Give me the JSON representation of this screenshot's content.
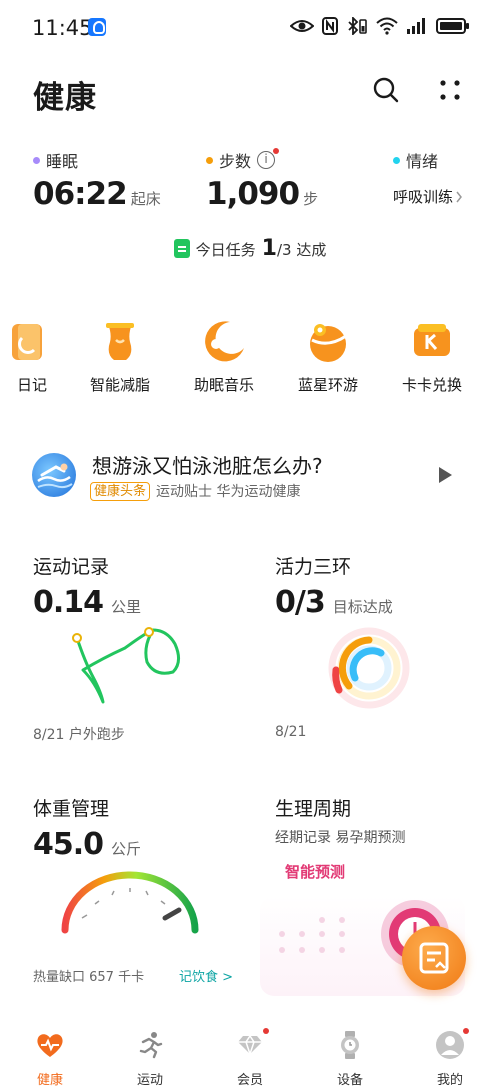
{
  "status_bar": {
    "time": "11:45"
  },
  "header": {
    "title": "健康"
  },
  "metrics": {
    "sleep": {
      "label": "睡眠",
      "value": "06:22",
      "unit": "起床",
      "color": "#a78bfa"
    },
    "steps": {
      "label": "步数",
      "value": "1,090",
      "unit": "步",
      "color": "#f59e0b"
    },
    "mood": {
      "label": "情绪",
      "link": "呼吸训练",
      "color": "#22d3ee"
    }
  },
  "task": {
    "label": "今日任务",
    "done": "1",
    "total": "/3 达成"
  },
  "shortcuts": [
    {
      "label": "日记",
      "icon": "diary-icon"
    },
    {
      "label": "智能减脂",
      "icon": "fat-loss-icon"
    },
    {
      "label": "助眠音乐",
      "icon": "sleep-music-icon"
    },
    {
      "label": "蓝星环游",
      "icon": "blue-planet-icon"
    },
    {
      "label": "卡卡兑换",
      "icon": "card-exchange-icon"
    }
  ],
  "banner": {
    "title": "想游泳又怕泳池脏怎么办?",
    "tag": "健康头条",
    "subtitle": "运动贴士 华为运动健康"
  },
  "cards": {
    "exercise": {
      "title": "运动记录",
      "value": "0.14",
      "unit": "公里",
      "foot": "8/21 户外跑步"
    },
    "rings": {
      "title": "活力三环",
      "value": "0/3",
      "unit": "目标达成",
      "foot": "8/21"
    },
    "weight": {
      "title": "体重管理",
      "value": "45.0",
      "unit": "公斤",
      "foot": "热量缺口 657 千卡",
      "link": "记饮食 >"
    },
    "cycle": {
      "title": "生理周期",
      "subtitle": "经期记录 易孕期预测",
      "link": "智能预测"
    }
  },
  "bottom_nav": [
    {
      "label": "健康",
      "icon": "heart-icon",
      "active": true
    },
    {
      "label": "运动",
      "icon": "runner-icon",
      "active": false
    },
    {
      "label": "会员",
      "icon": "diamond-icon",
      "active": false
    },
    {
      "label": "设备",
      "icon": "watch-icon",
      "active": false
    },
    {
      "label": "我的",
      "icon": "profile-icon",
      "active": false
    }
  ],
  "colors": {
    "accent": "#f26b1d",
    "primary_text": "#1a1a1a",
    "cycle_link": "#e23a75"
  }
}
